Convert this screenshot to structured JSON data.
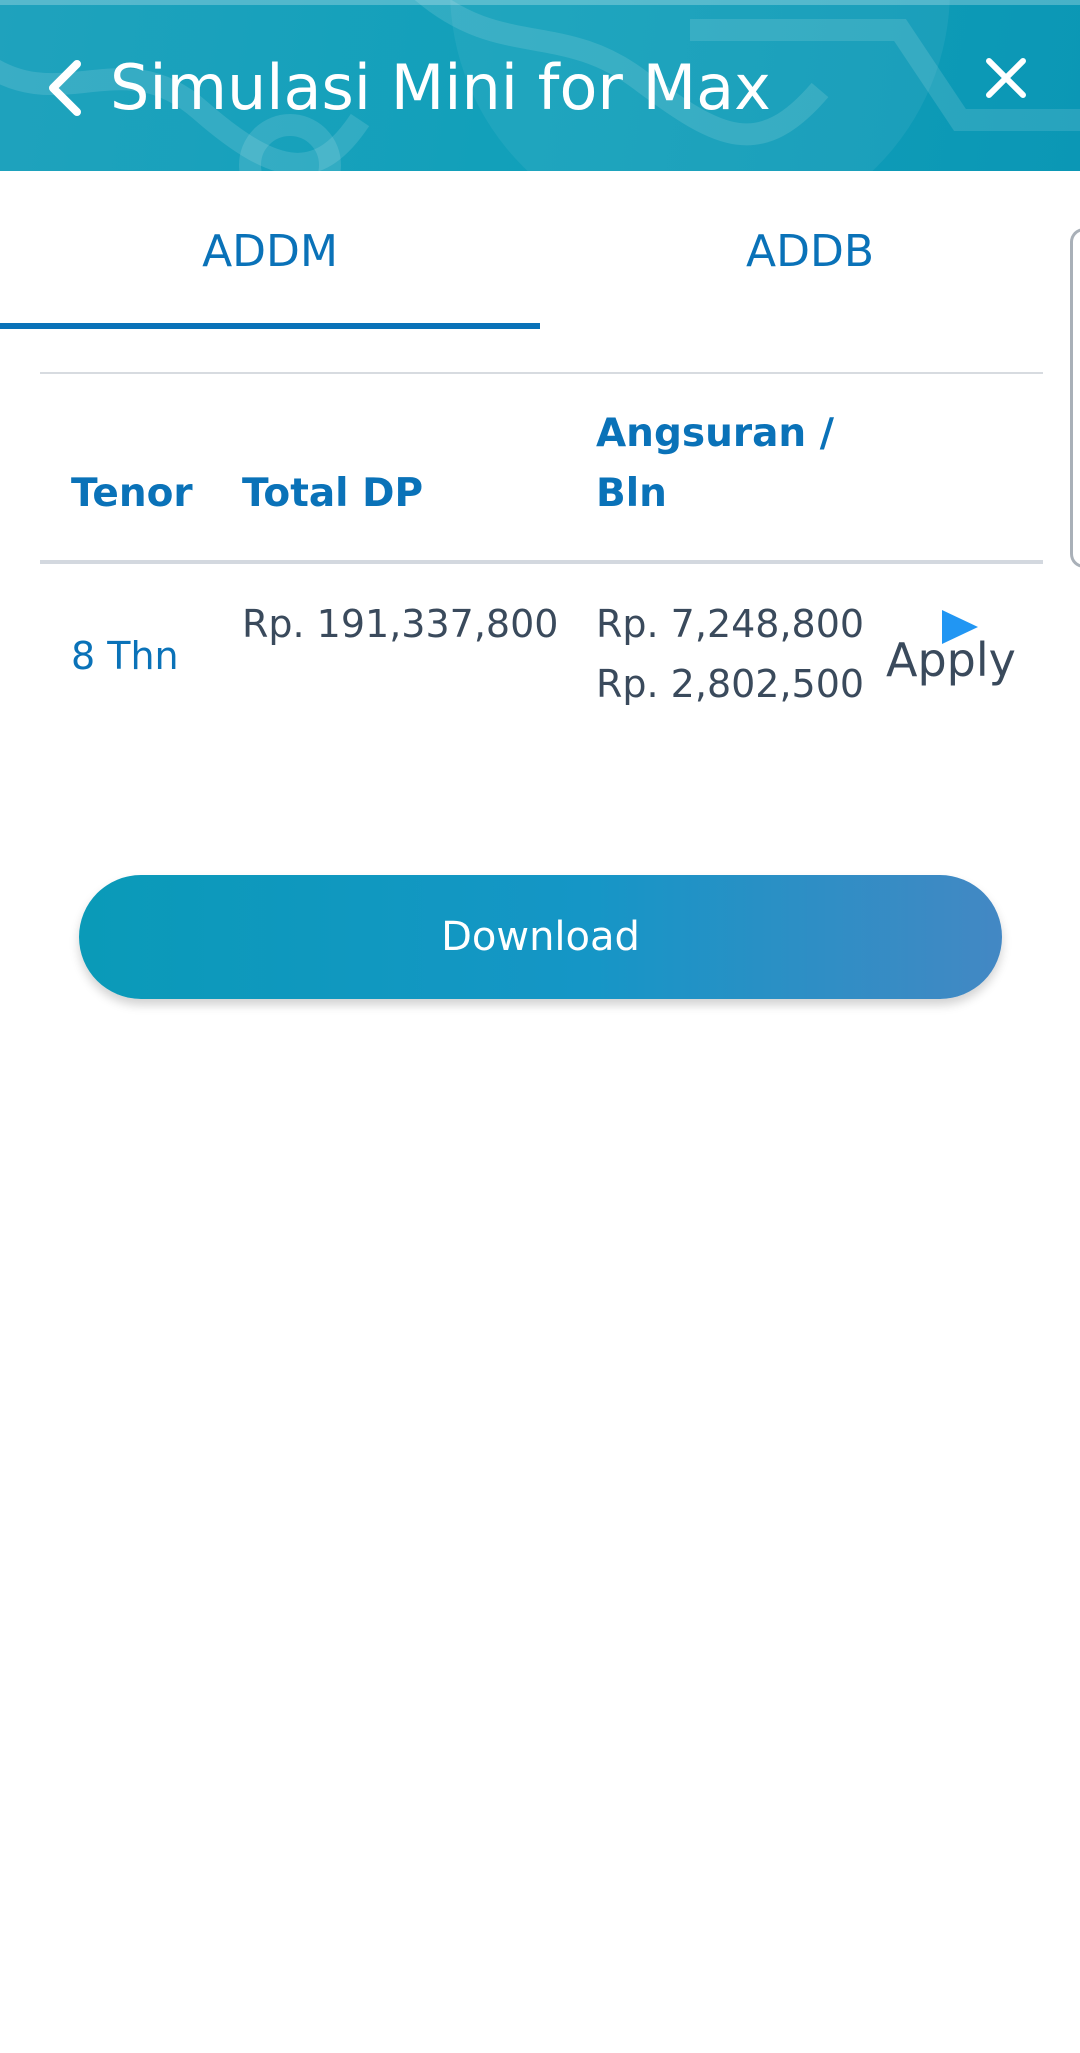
{
  "header": {
    "title": "Simulasi Mini for Max",
    "back_icon": "chevron-left-icon",
    "close_icon": "close-icon",
    "bg_color": "#11a0ba"
  },
  "tabs": [
    {
      "label": "ADDM",
      "active": true
    },
    {
      "label": "ADDB",
      "active": false
    }
  ],
  "table": {
    "headers": {
      "tenor": "Tenor",
      "total_dp": "Total DP",
      "angsuran": "Angsuran / Bln"
    },
    "rows": [
      {
        "tenor": "8 Thn",
        "total_dp": "Rp. 191,337,800",
        "angsuran": [
          "Rp. 7,248,800",
          "Rp. 2,802,500"
        ],
        "action_label": "Apply",
        "action_icon": "play-triangle-icon"
      }
    ]
  },
  "download": {
    "label": "Download"
  },
  "colors": {
    "accent": "#0a72b8",
    "text": "#3a4a5c",
    "button_start": "#0a9ab8",
    "button_end": "#4388c4",
    "apply_icon": "#2196f3"
  }
}
